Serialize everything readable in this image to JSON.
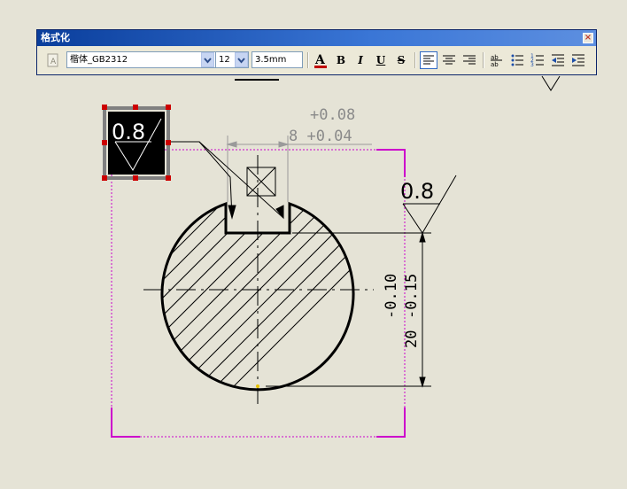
{
  "window": {
    "title": "格式化",
    "close_icon": "close-icon"
  },
  "toolbar": {
    "font_name": "楷体_GB2312",
    "font_size": "12",
    "text_height": "3.5mm",
    "buttons": {
      "text_style": "text-style-icon",
      "color": "A",
      "bold": "B",
      "italic": "I",
      "underline": "U",
      "strikethrough": "S",
      "align_left": "align-left-icon",
      "align_center": "align-center-icon",
      "align_right": "align-right-icon",
      "stack": "stack-icon",
      "bullet_list": "bullet-list-icon",
      "numbered_list": "numbered-list-icon",
      "outdent": "outdent-icon",
      "indent": "indent-icon"
    },
    "active_button": "align_left"
  },
  "drawing": {
    "roughness_selected": "0.8",
    "roughness_top": "0.8",
    "tolerance_upper": "+0.08",
    "tolerance_lower": "8 +0.04",
    "vertical_dim_tolerance": "-0.10",
    "vertical_dim_tolerance2": "-0.15",
    "vertical_dim_value": "20",
    "colors": {
      "selection_box": "#cc00cc",
      "grip": "#cc0000",
      "dim_line": "#9a9a9a"
    }
  }
}
